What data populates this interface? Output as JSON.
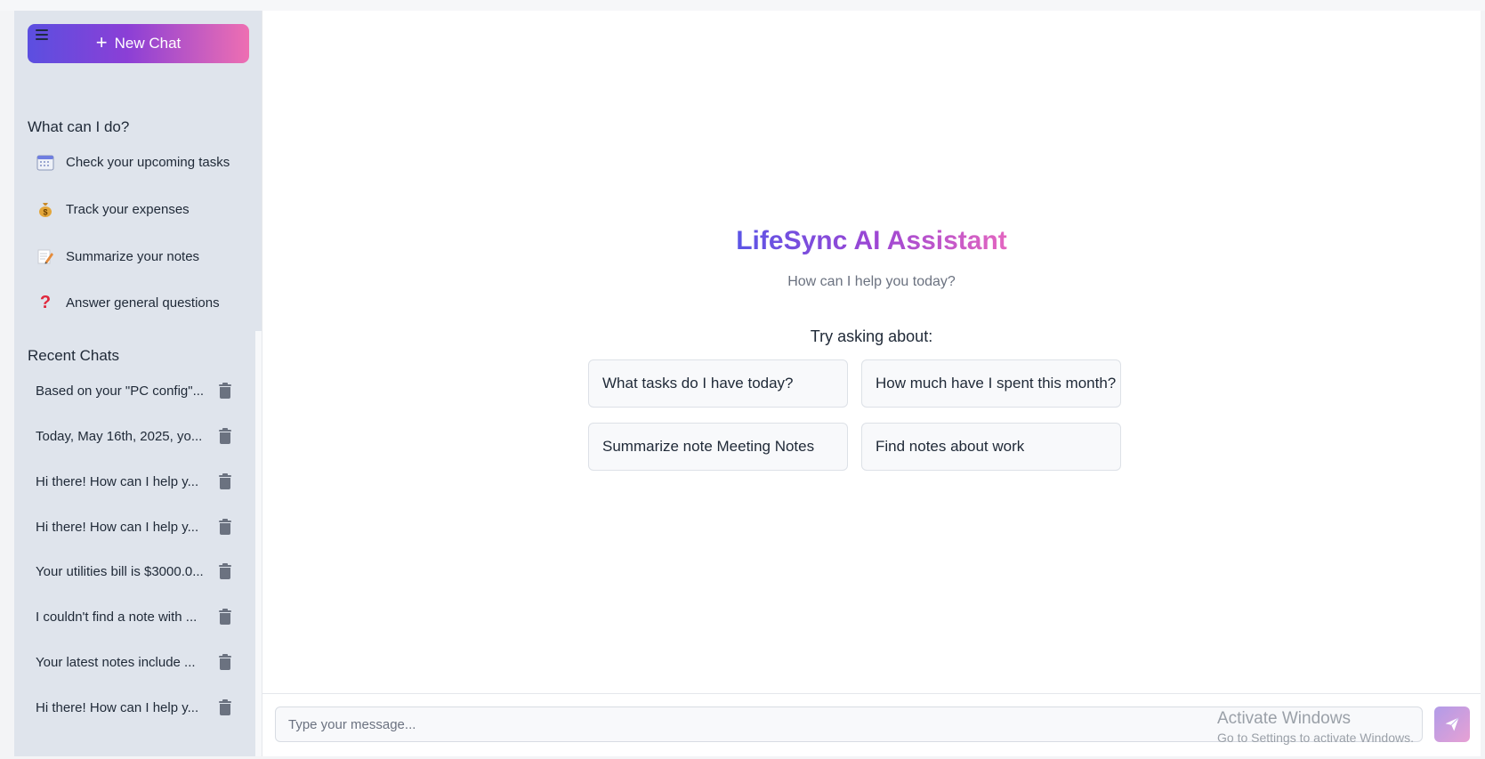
{
  "sidebar": {
    "new_chat_label": "New Chat",
    "capabilities_title": "What can I do?",
    "capabilities": [
      {
        "icon": "calendar-icon",
        "label": "Check your upcoming tasks"
      },
      {
        "icon": "money-bag-icon",
        "label": "Track your expenses"
      },
      {
        "icon": "memo-icon",
        "label": "Summarize your notes"
      },
      {
        "icon": "question-icon",
        "label": "Answer general questions"
      }
    ],
    "recent_title": "Recent Chats",
    "recent_chats": [
      "Based on your \"PC config\"...",
      "Today, May 16th, 2025, yo...",
      "Hi there! How can I help y...",
      "Hi there! How can I help y...",
      "Your utilities bill is $3000.0...",
      "I couldn't find a note with ...",
      "Your latest notes include ...",
      "Hi there! How can I help y..."
    ]
  },
  "main": {
    "title": "LifeSync AI Assistant",
    "subtitle": "How can I help you today?",
    "try_label": "Try asking about:",
    "suggestions": [
      "What tasks do I have today?",
      "How much have I spent this month?",
      "Summarize note Meeting Notes",
      "Find notes about work"
    ],
    "input_placeholder": "Type your message..."
  },
  "watermark": {
    "line1": "Activate Windows",
    "line2": "Go to Settings to activate Windows."
  },
  "colors": {
    "accent_start": "#5b4fe0",
    "accent_end": "#ee6fb2",
    "sidebar_bg": "#dfe4ec"
  }
}
